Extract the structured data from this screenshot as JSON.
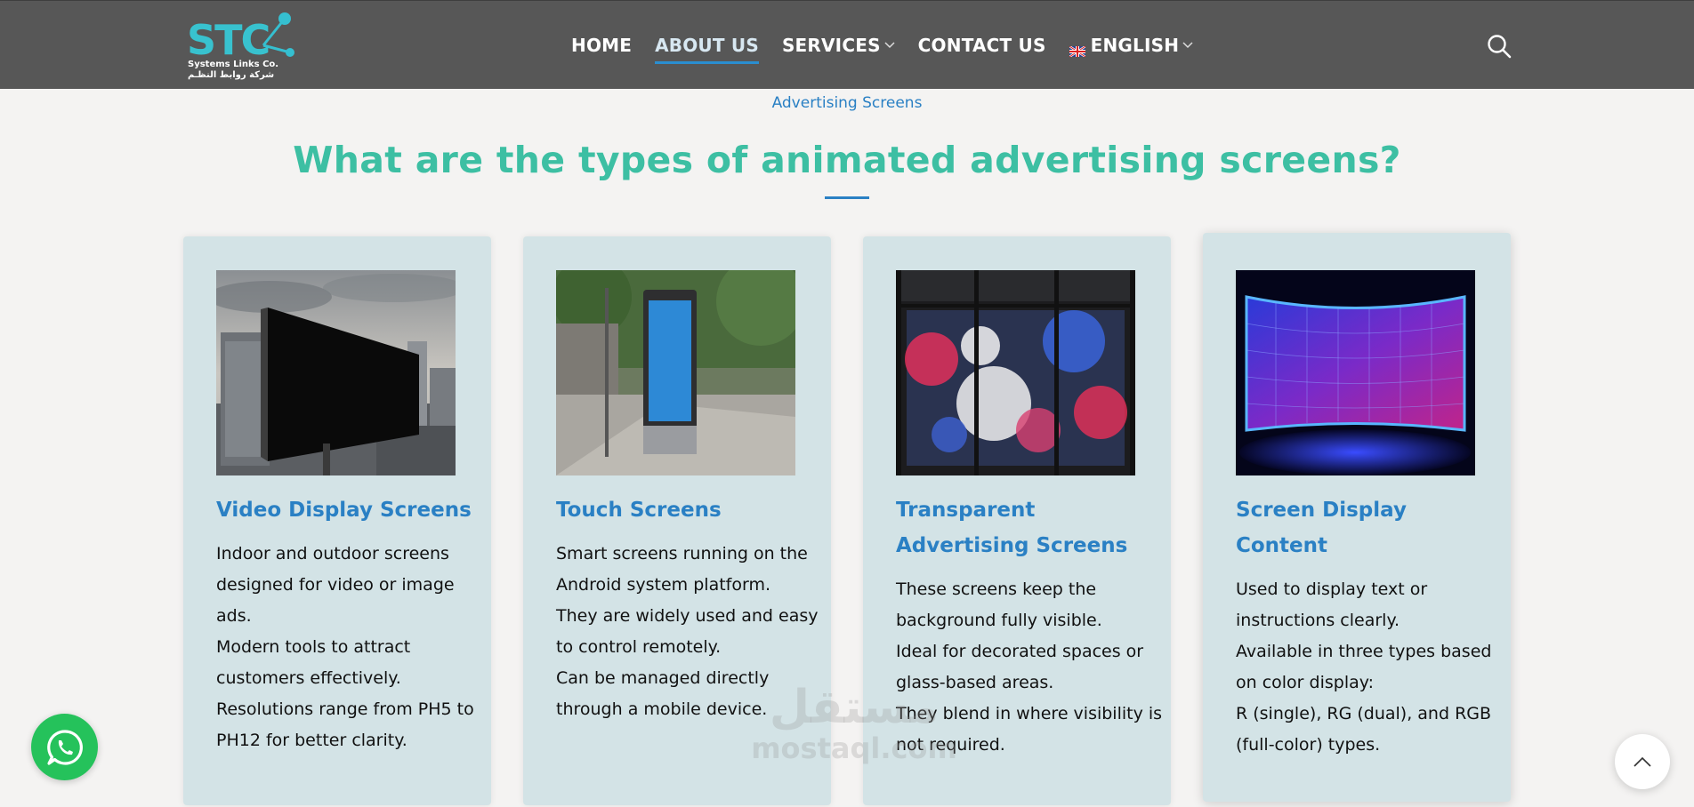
{
  "header": {
    "logo": {
      "sub_en": "Systems Links Co.",
      "sub_ar": "شركة روابط النظـم"
    },
    "nav": [
      {
        "label": "HOME"
      },
      {
        "label": "ABOUT US"
      },
      {
        "label": "SERVICES"
      },
      {
        "label": "CONTACT US"
      },
      {
        "label": "ENGLISH"
      }
    ]
  },
  "section": {
    "eyebrow": "Advertising Screens",
    "heading": "What are the types of animated advertising screens?"
  },
  "cards": [
    {
      "title": "Video Display Screens",
      "lines": [
        "Indoor and outdoor screens designed for video or image ads.",
        "Modern tools to attract customers effectively.",
        "Resolutions range from PH5 to PH12 for better clarity."
      ]
    },
    {
      "title": "Touch Screens",
      "lines": [
        "Smart screens running on the Android system platform.",
        "They are widely used and easy to control remotely.",
        "Can be managed directly through a mobile device."
      ]
    },
    {
      "title": "Transparent Advertising Screens",
      "lines": [
        "These screens keep the background fully visible.",
        "Ideal for decorated spaces or glass-based areas.",
        "They blend in where visibility is not required."
      ]
    },
    {
      "title": "Screen Display Content",
      "lines": [
        "Used to display text or instructions clearly.",
        "Available in three types based on color display:",
        "R (single), RG (dual), and RGB (full-color) types."
      ]
    }
  ],
  "watermark": {
    "ar": "مستقل",
    "en": "mostaql.com"
  }
}
